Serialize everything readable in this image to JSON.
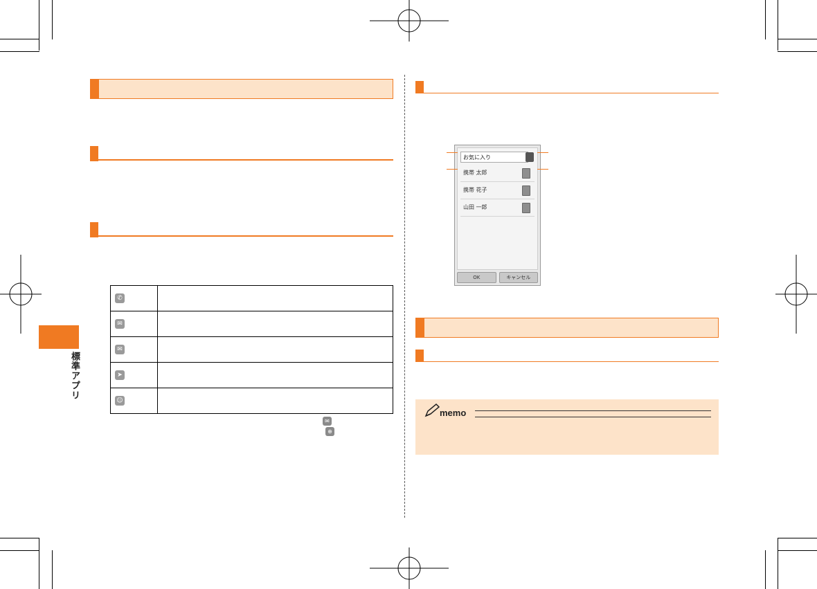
{
  "side_tab": {
    "label": "標準アプリ",
    "color": "#f07a22"
  },
  "accent_color": "#f07a22",
  "band_color": "#fde3c9",
  "icon_table": {
    "rows": [
      {
        "icon": "phone-icon",
        "glyph": "✆"
      },
      {
        "icon": "sms-icon",
        "glyph": "✉"
      },
      {
        "icon": "email-icon",
        "glyph": "✉"
      },
      {
        "icon": "twitter-icon",
        "glyph": "➤"
      },
      {
        "icon": "message-bubble-icon",
        "glyph": "☺"
      }
    ]
  },
  "inline_icons": [
    {
      "icon": "sms-icon",
      "glyph": "✉"
    },
    {
      "icon": "globe-icon",
      "glyph": "⊕"
    }
  ],
  "phone_screen": {
    "favorites_label": "お気に入り",
    "contacts": [
      {
        "name": "携帯 太郎"
      },
      {
        "name": "携帯 花子"
      },
      {
        "name": "山田 一郎"
      }
    ],
    "ok_label": "OK",
    "cancel_label": "キャンセル"
  },
  "memo": {
    "title": "memo"
  }
}
